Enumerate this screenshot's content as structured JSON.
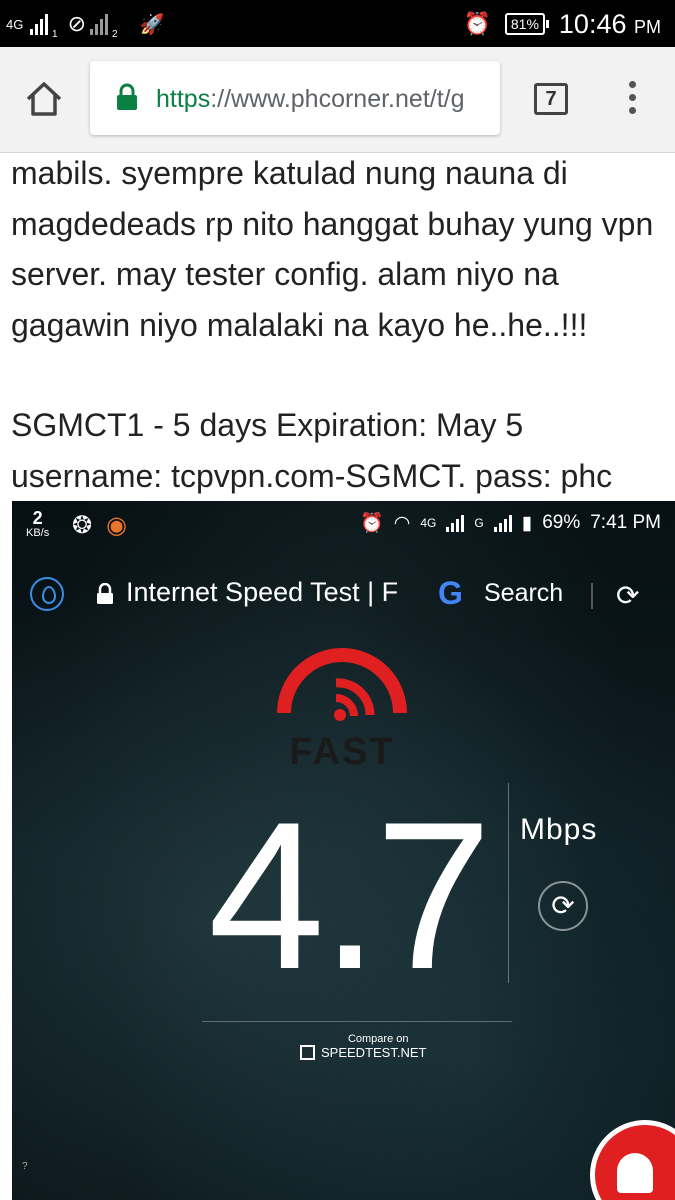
{
  "status_bar": {
    "network_type": "4G",
    "sim1": "1",
    "sim2": "2",
    "battery": "81%",
    "time": "10:46",
    "ampm": "PM"
  },
  "browser": {
    "url_scheme": "https",
    "url_rest": "://www.phcorner.net/t/g",
    "tab_count": "7"
  },
  "post": {
    "lines": [
      "mabils. syempre katulad nung nauna di",
      "magdedeads rp nito hanggat buhay yung vpn",
      "server. may tester config. alam niyo na",
      "gagawin niyo malalaki na kayo he..he..!!!",
      "SGMCT1 - 5 days Expiration: May 5",
      "username: tcpvpn.com-SGMCT. pass: phc"
    ]
  },
  "screenshot": {
    "data_rate": "2",
    "data_rate_unit": "KB/s",
    "net": "4G",
    "net2": "G",
    "battery": "69%",
    "time": "7:41 PM",
    "page_title": "Internet Speed Test | F",
    "google_letter": "G",
    "search_label": "Search",
    "logo_text": "FAST",
    "speed_value": "4.7",
    "speed_unit": "Mbps",
    "compare_label": "Compare on",
    "compare_site": "SPEEDTEST.NET",
    "corner": "?"
  },
  "colors": {
    "secure_green": "#0b8043",
    "fast_red": "#e02020",
    "chrome_toolbar": "#f2f2f2"
  }
}
